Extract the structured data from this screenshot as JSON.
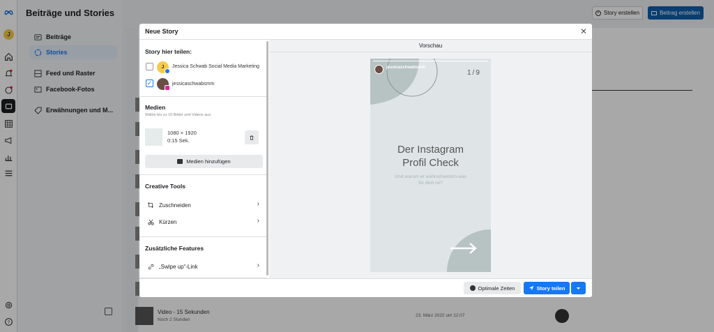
{
  "app": {
    "title": "Beiträge und Stories"
  },
  "rail": {
    "avatar_letter": "J"
  },
  "nav": {
    "items": [
      {
        "label": "Beiträge",
        "active": false
      },
      {
        "label": "Stories",
        "active": true
      },
      {
        "label": "Feed und Raster",
        "active": false
      },
      {
        "label": "Facebook-Fotos",
        "active": false
      },
      {
        "label": "Erwähnungen und M...",
        "active": false
      }
    ]
  },
  "header": {
    "story_create": "Story erstellen",
    "post_create": "Beitrag erstellen"
  },
  "background_row": {
    "title": "Video - 15 Sekunden",
    "subtitle": "Noch 2 Stunden",
    "date": "23. März 2022 um 12:07"
  },
  "modal": {
    "title": "Neue Story",
    "share_title": "Story hier teilen:",
    "accounts": [
      {
        "name": "Jessica Schwab Social Media Marketing",
        "checked": false,
        "platform": "facebook-icon"
      },
      {
        "name": "jessicaschwabsmm",
        "checked": true,
        "platform": "instagram-icon"
      }
    ],
    "media_title": "Medien",
    "media_sub": "Wähle bis zu 10 Bilder und Videos aus.",
    "media_item": {
      "dims": "1080 × 1920",
      "duration": "0:15 Sek."
    },
    "add_media": "Medien hinzufügen",
    "creative_title": "Creative Tools",
    "tools": [
      "Zuschneiden",
      "Kürzen"
    ],
    "extra_title": "Zusätzliche Features",
    "swipe_label": "„Swipe up“-Link",
    "preview_title": "Vorschau",
    "story": {
      "username": "jessicaschwabsmm",
      "counter": "1/9",
      "headline1": "Der Instagram",
      "headline2": "Profil Check",
      "sub1": "Und warum er wahrscheinlich was",
      "sub2": "für dich ist?"
    },
    "footer": {
      "best_times": "Optimale Zeiten",
      "share": "Story teilen"
    }
  },
  "colors": {
    "accent": "#1877f2",
    "dark_button": "#0f5fae"
  }
}
